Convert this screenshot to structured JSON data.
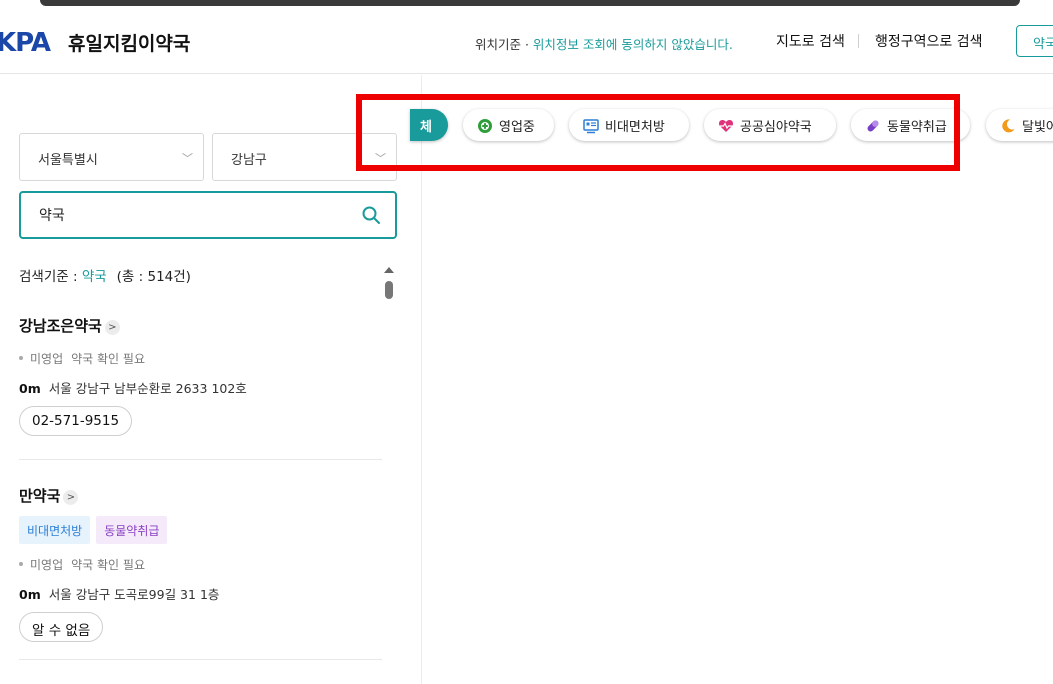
{
  "header": {
    "logo_text": "KPA",
    "site_title": "휴일지킴이약국",
    "location_label": "위치기준 · ",
    "location_link": "위치정보 조회에 동의하지 않았습니다.",
    "nav_map": "지도로 검색",
    "nav_region": "행정구역으로 검색",
    "header_button": "약국"
  },
  "search": {
    "city": "서울특별시",
    "district": "강남구",
    "query": "약국"
  },
  "results": {
    "criteria_label": "검색기준 : ",
    "criteria_keyword": "약국",
    "total_text": "(총 : 514건)",
    "items": [
      {
        "name": "강남조은약국",
        "tags": [],
        "status": "미영업",
        "status_note": "약국 확인 필요",
        "distance": "0m",
        "address": "서울 강남구 남부순환로 2633 102호",
        "phone": "02-571-9515"
      },
      {
        "name": "만약국",
        "tags": [
          "비대면처방",
          "동물약취급"
        ],
        "status": "미영업",
        "status_note": "약국 확인 필요",
        "distance": "0m",
        "address": "서울 강남구 도곡로99길 31 1층",
        "phone": "알 수 없음"
      }
    ]
  },
  "filters": [
    {
      "label": "체",
      "icon": "none"
    },
    {
      "label": "영업중",
      "icon": "plus-circle-icon"
    },
    {
      "label": "비대면처방",
      "icon": "monitor-icon"
    },
    {
      "label": "공공심야약국",
      "icon": "heart-pulse-icon"
    },
    {
      "label": "동물약취급",
      "icon": "pill-icon"
    },
    {
      "label": "달빛어",
      "icon": "moon-icon"
    }
  ],
  "colors": {
    "accent": "#1a9b9b",
    "brand": "#1a47a8",
    "highlight": "#ee0000"
  }
}
